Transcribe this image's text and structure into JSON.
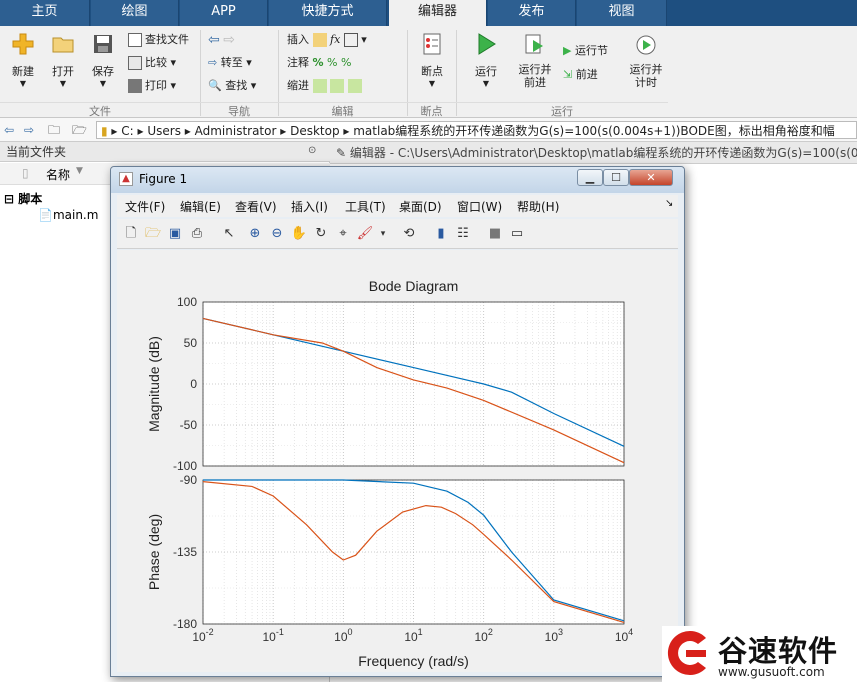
{
  "tabs": [
    "主页",
    "绘图",
    "APP",
    "快捷方式",
    "编辑器",
    "发布",
    "视图"
  ],
  "ribbon": {
    "new": "新建",
    "open": "打开",
    "save": "保存",
    "find_files": "查找文件",
    "compare": "比较",
    "print": "打印",
    "goto": "转至",
    "find": "查找",
    "insert": "插入",
    "comment": "注释",
    "indent": "缩进",
    "breakpoints": "断点",
    "run": "运行",
    "run_advance": "运行并\n前进",
    "run_section": "运行节",
    "advance": "前进",
    "run_time": "运行并\n计时",
    "groups": {
      "file": "文件",
      "navigate": "导航",
      "edit": "编辑",
      "breakpoints": "断点",
      "run": "运行"
    }
  },
  "address": {
    "crumbs": [
      "C:",
      "Users",
      "Administrator",
      "Desktop",
      "matlab编程系统的开环传递函数为G(s)=100(s(0.004s+1))BODE图，标出相角裕度和幅"
    ]
  },
  "left_panel": {
    "title": "当前文件夹",
    "col_name": "名称",
    "folder": "脚本",
    "file": "main.m"
  },
  "editor_header": "编辑器 - C:\\Users\\Administrator\\Desktop\\matlab编程系统的开环传递函数为G(s)=100(s(0.004s+1))",
  "figure": {
    "title": "Figure 1",
    "menus": [
      "文件(F)",
      "编辑(E)",
      "查看(V)",
      "插入(I)",
      "工具(T)",
      "桌面(D)",
      "窗口(W)",
      "帮助(H)"
    ]
  },
  "chart_data": {
    "type": "line",
    "title": "Bode Diagram",
    "xlabel": "Frequency  (rad/s)",
    "xscale": "log",
    "xlim": [
      0.01,
      10000
    ],
    "xticks": [
      "10^-2",
      "10^-1",
      "10^0",
      "10^1",
      "10^2",
      "10^3",
      "10^4"
    ],
    "colors": [
      "#0072bd",
      "#d95319"
    ],
    "panels": [
      {
        "ylabel": "Magnitude (dB)",
        "ylim": [
          -100,
          100
        ],
        "yticks": [
          "100",
          "50",
          "0",
          "-50",
          "-100"
        ],
        "series": [
          {
            "x": [
              0.01,
              0.1,
              1,
              10,
              100,
              250,
              1000,
              10000
            ],
            "y": [
              80,
              60,
              40,
              20,
              0,
              -10,
              -36,
              -76
            ]
          },
          {
            "x": [
              0.01,
              0.1,
              0.5,
              1,
              3,
              10,
              30,
              100,
              1000,
              10000
            ],
            "y": [
              80,
              60,
              50,
              40,
              20,
              5,
              -5,
              -20,
              -56,
              -96
            ]
          }
        ]
      },
      {
        "ylabel": "Phase (deg)",
        "ylim": [
          -180,
          -90
        ],
        "yticks": [
          "-90",
          "-135",
          "-180"
        ],
        "series": [
          {
            "x": [
              0.01,
              0.1,
              1,
              10,
              30,
              60,
              100,
              250,
              1000,
              10000
            ],
            "y": [
              -90,
              -90,
              -90,
              -92,
              -97,
              -104,
              -112,
              -135,
              -165,
              -178
            ]
          },
          {
            "x": [
              0.01,
              0.05,
              0.1,
              0.3,
              0.7,
              1,
              1.5,
              3,
              7,
              15,
              25,
              40,
              70,
              100,
              250,
              1000,
              10000
            ],
            "y": [
              -91,
              -94,
              -100,
              -118,
              -135,
              -140,
              -137,
              -122,
              -110,
              -106,
              -107,
              -111,
              -118,
              -124,
              -140,
              -166,
              -179
            ]
          }
        ]
      }
    ]
  },
  "watermark": {
    "brand": "谷速软件",
    "url": "www.gusuoft.com"
  }
}
